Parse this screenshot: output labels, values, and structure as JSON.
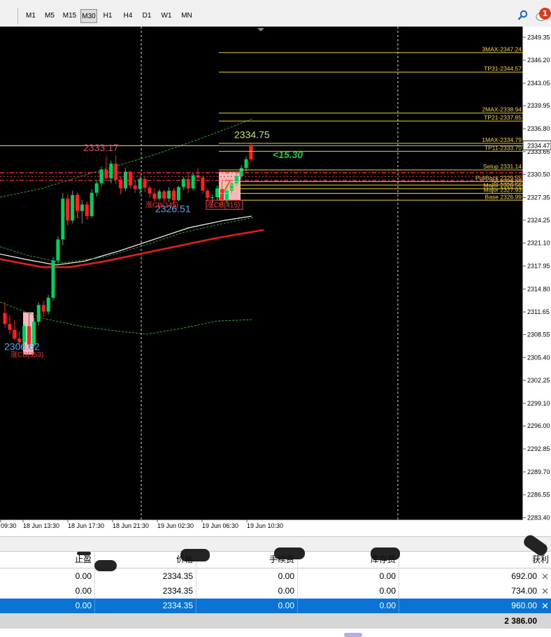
{
  "toolbar": {
    "timeframes": [
      "M1",
      "M5",
      "M15",
      "M30",
      "H1",
      "H4",
      "D1",
      "W1",
      "MN"
    ],
    "active": "M30",
    "notification_count": "1",
    "search_icon": "search-icon",
    "chat_icon": "chat-bubble-icon"
  },
  "chart_data": {
    "type": "candlestick",
    "ylim": [
      2283.4,
      2350.0
    ],
    "price_ticks": [
      "2349.35",
      "2346.20",
      "2343.05",
      "2339.95",
      "2336.80",
      "2333.65",
      "2330.50",
      "2327.35",
      "2324.25",
      "2321.10",
      "2317.95",
      "2314.80",
      "2311.65",
      "2308.55",
      "2305.40",
      "2302.25",
      "2299.10",
      "2296.00",
      "2292.85",
      "2289.70",
      "2286.55",
      "2283.40"
    ],
    "time_ticks": [
      "09:30",
      "18 Jun 13:30",
      "18 Jun 17:30",
      "18 Jun 21:30",
      "19 Jun 02:30",
      "19 Jun 06:30",
      "19 Jun 10:30"
    ],
    "current_price": "2334.47",
    "levels": [
      {
        "label": "3MAX-2347.24",
        "value": 2347.24
      },
      {
        "label": "TP31-2344.57",
        "value": 2344.57
      },
      {
        "label": "2MAX-2338.94",
        "value": 2338.94
      },
      {
        "label": "TP21-2337.85",
        "value": 2337.85
      },
      {
        "label": "1MAX-2334.79",
        "value": 2334.79
      },
      {
        "label": "TP11-2333.70",
        "value": 2333.7
      },
      {
        "label": "Setup 2331.14",
        "value": 2331.14
      },
      {
        "label": "PullBack 2329.55",
        "value": 2329.55
      },
      {
        "label": "50 2329.05",
        "value": 2329.05
      },
      {
        "label": "Major 2328.56",
        "value": 2328.56
      },
      {
        "label": "Major 2327.93",
        "value": 2327.93
      },
      {
        "label": "Base 2326.99",
        "value": 2326.99
      }
    ],
    "annotations": {
      "high_label": "2333.17",
      "low_label": "2326.51",
      "low2_label": "2306.62",
      "recent_high_label": "2334.75",
      "delta_label": "<15.30",
      "cb_label_1": "涨CB(145)",
      "cb_label_2": "涨CB(415)",
      "cb_label_3": "涨CB(353)"
    },
    "candles": [
      [
        2311.5,
        2313.0,
        2309.5,
        2310.0
      ],
      [
        2310.0,
        2311.2,
        2308.6,
        2309.2
      ],
      [
        2309.2,
        2310.5,
        2307.8,
        2308.0
      ],
      [
        2308.0,
        2309.0,
        2307.0,
        2307.5
      ],
      [
        2307.5,
        2310.0,
        2306.9,
        2309.7
      ],
      [
        2309.7,
        2311.5,
        2306.6,
        2307.2
      ],
      [
        2307.2,
        2310.8,
        2306.8,
        2310.3
      ],
      [
        2310.3,
        2313.0,
        2309.8,
        2312.6
      ],
      [
        2312.6,
        2313.2,
        2311.0,
        2311.7
      ],
      [
        2311.7,
        2314.0,
        2311.3,
        2313.6
      ],
      [
        2313.6,
        2319.2,
        2313.2,
        2318.7
      ],
      [
        2318.7,
        2322.0,
        2318.0,
        2321.6
      ],
      [
        2321.6,
        2328.0,
        2320.8,
        2327.2
      ],
      [
        2327.2,
        2327.8,
        2323.5,
        2324.2
      ],
      [
        2324.2,
        2328.3,
        2323.8,
        2327.7
      ],
      [
        2327.7,
        2328.0,
        2324.5,
        2325.5
      ],
      [
        2325.5,
        2327.0,
        2323.8,
        2326.4
      ],
      [
        2326.4,
        2326.8,
        2324.3,
        2324.8
      ],
      [
        2324.8,
        2328.5,
        2324.5,
        2328.0
      ],
      [
        2328.0,
        2329.8,
        2327.5,
        2329.3
      ],
      [
        2329.3,
        2331.6,
        2328.8,
        2331.2
      ],
      [
        2331.2,
        2333.0,
        2329.5,
        2330.0
      ],
      [
        2330.0,
        2332.4,
        2329.3,
        2332.0
      ],
      [
        2332.0,
        2333.17,
        2329.2,
        2329.8
      ],
      [
        2329.8,
        2330.3,
        2327.8,
        2328.6
      ],
      [
        2328.6,
        2331.4,
        2328.2,
        2330.9
      ],
      [
        2330.9,
        2331.0,
        2328.6,
        2329.0
      ],
      [
        2329.0,
        2329.8,
        2328.0,
        2328.5
      ],
      [
        2328.5,
        2330.2,
        2327.8,
        2329.9
      ],
      [
        2329.9,
        2330.2,
        2328.1,
        2328.7
      ],
      [
        2328.7,
        2329.0,
        2327.3,
        2327.9
      ],
      [
        2327.9,
        2328.6,
        2326.8,
        2327.2
      ],
      [
        2327.2,
        2328.5,
        2326.9,
        2328.2
      ],
      [
        2328.2,
        2328.4,
        2326.8,
        2327.2
      ],
      [
        2327.2,
        2328.8,
        2326.7,
        2328.3
      ],
      [
        2328.3,
        2328.6,
        2326.51,
        2327.0
      ],
      [
        2327.0,
        2329.0,
        2326.8,
        2328.8
      ],
      [
        2328.8,
        2330.2,
        2328.4,
        2329.9
      ],
      [
        2329.9,
        2330.6,
        2328.0,
        2328.6
      ],
      [
        2328.6,
        2330.8,
        2328.3,
        2330.4
      ],
      [
        2330.4,
        2331.4,
        2329.6,
        2330.1
      ],
      [
        2330.1,
        2330.4,
        2327.9,
        2328.3
      ],
      [
        2328.3,
        2328.6,
        2326.8,
        2327.3
      ],
      [
        2327.3,
        2327.8,
        2326.6,
        2327.4
      ],
      [
        2327.4,
        2329.0,
        2327.0,
        2328.6
      ],
      [
        2328.6,
        2329.6,
        2326.3,
        2326.9
      ],
      [
        2326.9,
        2328.8,
        2326.5,
        2328.3
      ],
      [
        2328.3,
        2329.7,
        2327.9,
        2329.3
      ],
      [
        2329.3,
        2330.6,
        2328.9,
        2330.3
      ],
      [
        2330.3,
        2331.8,
        2329.9,
        2331.4
      ],
      [
        2331.4,
        2333.0,
        2330.9,
        2332.6
      ],
      [
        2332.6,
        2334.75,
        2332.2,
        2334.47
      ]
    ]
  },
  "table": {
    "headers": [
      "止盈",
      "价格",
      "手续费",
      "库存费",
      "获利"
    ],
    "rows": [
      {
        "tp": "0.00",
        "price": "2334.35",
        "fee": "0.00",
        "swap": "0.00",
        "profit": "692.00"
      },
      {
        "tp": "0.00",
        "price": "2334.35",
        "fee": "0.00",
        "swap": "0.00",
        "profit": "734.00"
      },
      {
        "tp": "0.00",
        "price": "2334.35",
        "fee": "0.00",
        "swap": "0.00",
        "profit": "960.00"
      }
    ],
    "total": "2 386.00",
    "close_icon": "close-icon"
  }
}
